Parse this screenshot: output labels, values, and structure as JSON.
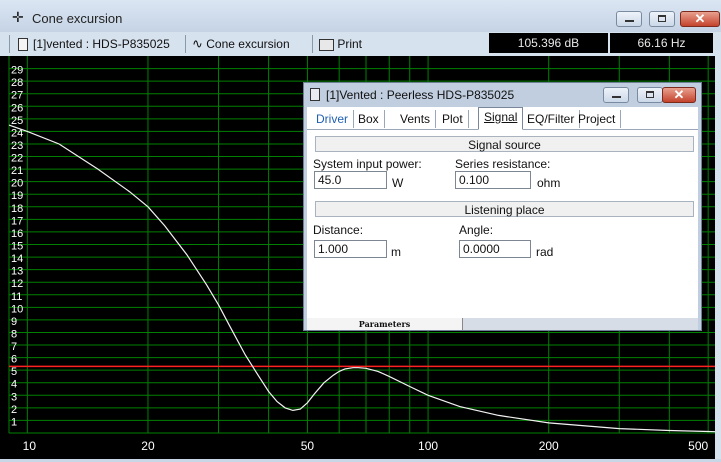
{
  "window": {
    "title": "Cone excursion",
    "icon": "crosshair-icon"
  },
  "toolbar": {
    "driver_select": "[1]vented : HDS-P835025",
    "plot_select": "Cone excursion",
    "print_label": "Print",
    "readout_db": "105.396 dB",
    "readout_hz": "66.16 Hz"
  },
  "colors": {
    "plot_background": "#000000",
    "grid": "#008000",
    "curve": "#f2f2f2",
    "marker_line": "#ff2020",
    "axis_text": "#ffffff"
  },
  "chart_data": {
    "type": "line",
    "x_scale": "log",
    "xlim": [
      9,
      520
    ],
    "ylim": [
      0,
      30
    ],
    "grid": true,
    "x_ticks": [
      "10",
      "20",
      "50",
      "100",
      "200",
      "500"
    ],
    "y_ticks": [
      "1",
      "2",
      "3",
      "4",
      "5",
      "6",
      "7",
      "8",
      "9",
      "10",
      "11",
      "12",
      "13",
      "14",
      "15",
      "16",
      "17",
      "18",
      "19",
      "20",
      "21",
      "22",
      "23",
      "24",
      "25",
      "26",
      "27",
      "28",
      "29"
    ],
    "marker_y": 5.3,
    "series": [
      {
        "x": [
          9,
          10,
          12,
          15,
          18,
          20,
          22,
          25,
          28,
          30,
          32,
          35,
          38,
          40,
          42,
          44,
          46,
          48,
          50,
          52,
          55,
          58,
          60,
          62,
          65,
          67,
          70,
          75,
          80,
          90,
          100,
          120,
          150,
          200,
          300,
          400,
          500,
          520
        ],
        "y": [
          24.5,
          24.0,
          23.0,
          21.0,
          19.2,
          18.0,
          16.5,
          14.2,
          11.8,
          10.2,
          8.5,
          6.2,
          4.4,
          3.3,
          2.5,
          2.0,
          1.8,
          1.9,
          2.4,
          3.1,
          4.0,
          4.6,
          4.9,
          5.1,
          5.2,
          5.2,
          5.15,
          4.9,
          4.5,
          3.7,
          3.0,
          2.1,
          1.4,
          0.8,
          0.35,
          0.2,
          0.12,
          0.1
        ]
      }
    ]
  },
  "dialog": {
    "title": "[1]Vented : Peerless HDS-P835025",
    "tabs": [
      "Driver",
      "Box",
      "Vents",
      "Plot",
      "Signal",
      "EQ/Filter",
      "Project"
    ],
    "active_tab": "Signal",
    "signal_source": {
      "header": "Signal source",
      "power_label": "System input power:",
      "power_value": "45.0",
      "power_unit": "W",
      "resistance_label": "Series resistance:",
      "resistance_value": "0.100",
      "resistance_unit": "ohm"
    },
    "listening_place": {
      "header": "Listening place",
      "distance_label": "Distance:",
      "distance_value": "1.000",
      "distance_unit": "m",
      "angle_label": "Angle:",
      "angle_value": "0.0000",
      "angle_unit": "rad"
    },
    "footer_tab": "Parameters"
  }
}
